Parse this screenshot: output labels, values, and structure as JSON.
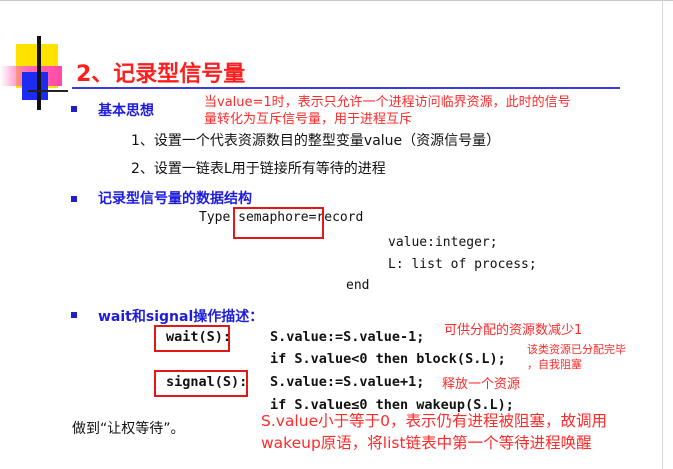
{
  "title": "2、记录型信号量",
  "section1": {
    "heading": "基本思想",
    "annotation_line1": "当value=1时，表示只允许一个进程访问临界资源，此时的信号",
    "annotation_line2": "量转化为互斥信号量，用于进程互斥",
    "item1": "1、设置一个代表资源数目的整型变量value（资源信号量）",
    "item2": "2、设置一链表L用于链接所有等待的进程"
  },
  "section2": {
    "heading": "记录型信号量的数据结构",
    "code_line1_prefix": "Type ",
    "code_line1_highlight": "semaphore",
    "code_line1_suffix": "=record",
    "code_line2": "value:integer;",
    "code_line3": "L: list of process;",
    "code_line4": "end"
  },
  "section3": {
    "heading": "wait和signal操作描述：",
    "wait_label": "wait(S):",
    "wait_line1": "S.value:=S.value-1;",
    "wait_line2": "if S.value<0 then block(S.L);",
    "signal_label": "signal(S):",
    "signal_line1": "S.value:=S.value+1;",
    "signal_line2": "if S.value≤0  then wakeup(S.L);",
    "note_wait1": "可供分配的资源数减少1",
    "note_wait2a": "该类资源已分配完毕",
    "note_wait2b": "，自我阻塞",
    "note_signal1": "释放一个资源",
    "footer_left": "做到“让权等待”。",
    "note_big1": "S.value小于等于0，表示仍有进程被阻塞，故调用",
    "note_big2": "wakeup原语，将list链表中第一个等待进程唤醒"
  },
  "colors": {
    "title_red": "#ff1e1e",
    "heading_blue": "#1d1ddb",
    "annotation_red": "#ff2a2a",
    "logo_yellow": "#ffe200",
    "logo_blue": "#1d2cf0",
    "logo_pink": "#ff6fb7"
  }
}
